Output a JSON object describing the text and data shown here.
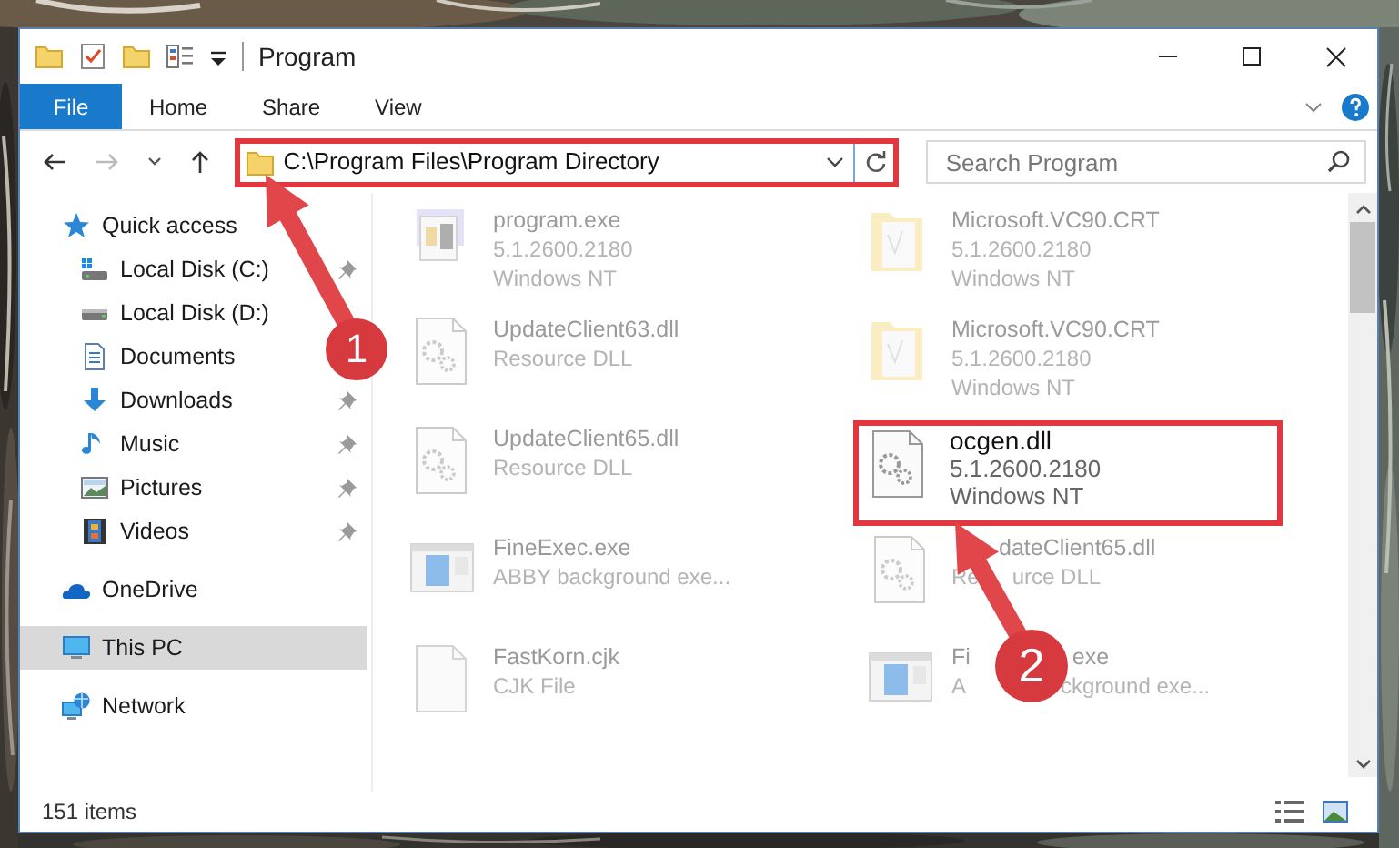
{
  "window": {
    "title": "Program"
  },
  "ribbon_tabs": [
    {
      "label": "File",
      "kind": "file",
      "selected": false
    },
    {
      "label": "Home",
      "kind": "tab",
      "selected": false
    },
    {
      "label": "Share",
      "kind": "tab",
      "selected": false
    },
    {
      "label": "View",
      "kind": "tab",
      "selected": false
    }
  ],
  "address_bar": {
    "path": "C:\\Program Files\\Program Directory",
    "highlighted": true
  },
  "search": {
    "placeholder": "Search Program"
  },
  "sidebar": {
    "items": [
      {
        "label": "Quick access",
        "selected": false,
        "children": [
          {
            "label": "Local Disk (C:)",
            "pinned": true,
            "selected": false
          },
          {
            "label": "Local Disk (D:)",
            "pinned": false,
            "selected": false
          },
          {
            "label": "Documents",
            "pinned": false,
            "selected": false
          },
          {
            "label": "Downloads",
            "pinned": true,
            "selected": false
          },
          {
            "label": "Music",
            "pinned": true,
            "selected": false
          },
          {
            "label": "Pictures",
            "pinned": true,
            "selected": false
          },
          {
            "label": "Videos",
            "pinned": true,
            "selected": false
          }
        ]
      },
      {
        "label": "OneDrive",
        "selected": false
      },
      {
        "label": "This PC",
        "selected": true
      },
      {
        "label": "Network",
        "selected": false
      }
    ]
  },
  "files": [
    {
      "kind": "app",
      "name": [
        "program.exe"
      ],
      "lines": [
        [
          "5.1.2600.2180"
        ],
        [
          "Windows NT"
        ]
      ],
      "highlighted": false
    },
    {
      "kind": "folder",
      "name": [
        "Microsoft.VC90.CRT"
      ],
      "lines": [
        [
          "5.1.2600.2180"
        ],
        [
          "Windows NT"
        ]
      ],
      "highlighted": false
    },
    {
      "kind": "dll",
      "name": [
        "UpdateClient63.dll"
      ],
      "lines": [
        [
          "Resource DLL"
        ]
      ],
      "highlighted": false
    },
    {
      "kind": "folder",
      "name": [
        "Microsoft.VC90.CRT"
      ],
      "lines": [
        [
          "5.1.2600.2180"
        ],
        [
          "Windows NT"
        ]
      ],
      "highlighted": false
    },
    {
      "kind": "dll",
      "name": [
        "UpdateClient65.dll"
      ],
      "lines": [
        [
          "Resource DLL"
        ]
      ],
      "highlighted": false
    },
    {
      "kind": "dll",
      "name": [
        "ocgen.dll"
      ],
      "lines": [
        [
          "5.1.2600.2180"
        ],
        [
          "Windows NT"
        ]
      ],
      "highlighted": true
    },
    {
      "kind": "window",
      "name": [
        "FineExec.exe"
      ],
      "lines": [
        [
          "ABBY background exe..."
        ]
      ],
      "highlighted": false
    },
    {
      "kind": "dll",
      "name": [
        "dateClient65.dll"
      ],
      "lines": [
        [
          "Re",
          "urce DLL"
        ]
      ],
      "highlighted": false
    },
    {
      "kind": "blank",
      "name": [
        "FastKorn.cjk"
      ],
      "lines": [
        [
          "CJK File"
        ]
      ],
      "highlighted": false
    },
    {
      "kind": "window",
      "name": [
        "Fi",
        "exe"
      ],
      "lines": [
        [
          "A",
          "ckground exe..."
        ]
      ],
      "highlighted": false
    }
  ],
  "status_bar": {
    "item_count": "151 items"
  },
  "annotations": [
    {
      "number": "1"
    },
    {
      "number": "2"
    }
  ]
}
